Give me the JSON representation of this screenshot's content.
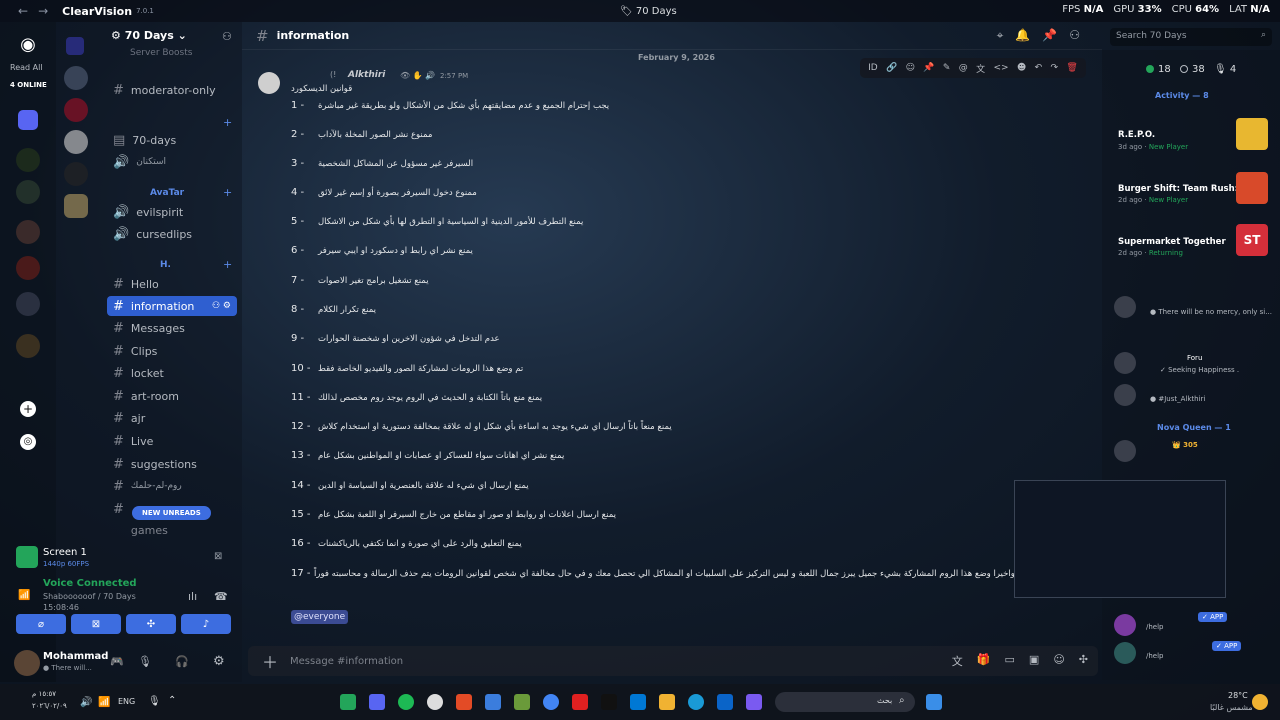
{
  "titlebar": {
    "app_name": "ClearVision",
    "version": "7.0.1",
    "window_title": "70 Days",
    "stats": [
      {
        "label": "FPS",
        "value": "N/A"
      },
      {
        "label": "GPU",
        "value": "33%"
      },
      {
        "label": "CPU",
        "value": "64%"
      },
      {
        "label": "LAT",
        "value": "N/A"
      }
    ]
  },
  "rail": {
    "read_all": "Read All",
    "online": "4 ONLINE"
  },
  "server": {
    "name": "70 Days",
    "partial_top": "Server Boosts",
    "channels": [
      {
        "name": "moderator-only"
      },
      {
        "name": "70-days"
      },
      {
        "name": "استكنان"
      },
      {
        "name": "evilspirit"
      },
      {
        "name": "cursedlips"
      },
      {
        "name": "Hello"
      },
      {
        "name": "information"
      },
      {
        "name": "Messages"
      },
      {
        "name": "Clips"
      },
      {
        "name": "locket"
      },
      {
        "name": "art-room"
      },
      {
        "name": "ajr"
      },
      {
        "name": "Live"
      },
      {
        "name": "suggestions"
      },
      {
        "name": "روم-لم-حلمك"
      },
      {
        "name": "games"
      }
    ],
    "categories": [
      "AvaTar",
      "H."
    ],
    "new_unreads": "NEW UNREADS"
  },
  "channel_header": {
    "name": "information"
  },
  "search": {
    "placeholder": "Search 70 Days"
  },
  "message": {
    "date": "February 9, 2026",
    "author": "Alkthiri",
    "time": "2:57 PM",
    "title": "قوانين الديسكورد",
    "rules": [
      {
        "n": "1 -",
        "text": "يجب إحترام الجميع و عدم مضايقتهم بأي شكل من الأشكال ولو بطريقة غير مباشرة"
      },
      {
        "n": "2 -",
        "text": "ممنوع نشر الصور المخلة بالآداب"
      },
      {
        "n": "3 -",
        "text": "السيرفر غير مسؤول عن المشاكل الشخصية"
      },
      {
        "n": "4 -",
        "text": "ممنوع دخول السيرفر بصورة أو إسم غير لائق"
      },
      {
        "n": "5 -",
        "text": "يمنع التطرف للأمور الدينية او السياسية او التطرق لها بأي شكل من الاشكال"
      },
      {
        "n": "6 -",
        "text": "يمنع نشر اي رابط او دسكورد او ايبي سيرفر"
      },
      {
        "n": "7 -",
        "text": "يمنع تشغيل برامج تغير الاصوات"
      },
      {
        "n": "8 -",
        "text": "يمنع تكرار الكلام"
      },
      {
        "n": "9 -",
        "text": "عدم التدخل في شؤون الاخرين او شخصنة الحوارات"
      },
      {
        "n": "10 -",
        "text": "تم وضع هذا الرومات لمشاركة الصور والفيديو الخاصة فقط"
      },
      {
        "n": "11 -",
        "text": "يمنع منع باتاً الكتابة و الحديث في الروم يوجد روم مخصص لذالك"
      },
      {
        "n": "12 -",
        "text": "يمنع منعاً باتاً ارسال اي شيء يوجد به اساءة بأي شكل او له علاقة بمخالفة دستورية او استخدام كلاش"
      },
      {
        "n": "13 -",
        "text": "يمنع نشر اي اهانات سواء للعساكر او عصابات او المواطنين بشكل عام"
      },
      {
        "n": "14 -",
        "text": "يمنع ارسال اي شيء له علاقة بالعنصرية او السياسة او الدين"
      },
      {
        "n": "15 -",
        "text": "يمنع ارسال اعلانات او روابط او صور او مقاطع من خارج السيرفر او اللعبة بشكل عام"
      },
      {
        "n": "16 -",
        "text": "يمنع التعليق والرد على اي صورة و انما تكتفي بالرياكشنات"
      },
      {
        "n": "17 -",
        "text": "واخيرا وضع هذا الروم المشاركة بشيء جميل يبرز جمال اللعبة و ليس التركيز على السلبيات او المشاكل الي تحصل معك و في حال مخالفة اي شخص لقوانين الرومات يتم حذف الرسالة و محاسبته فوراً"
      }
    ],
    "mention": "@everyone"
  },
  "composer": {
    "placeholder": "Message #information"
  },
  "voice": {
    "screen_label": "Screen 1",
    "screen_quality": "1440p 60FPS",
    "status": "Voice Connected",
    "location": "Shaboooooof / 70 Days",
    "elapsed": "15:08:46"
  },
  "user": {
    "name": "Mohammad",
    "status": "There will..."
  },
  "rightbar": {
    "counts": {
      "online": "18",
      "idle": "38",
      "voice": "4"
    },
    "activity_header": "Activity — 8",
    "activities": [
      {
        "title": "R.E.P.O.",
        "time": "3d ago",
        "tag": "New Player"
      },
      {
        "title": "Burger Shift: Team Rush: P...",
        "time": "2d ago",
        "tag": "New Player"
      },
      {
        "title": "Supermarket Together",
        "time": "2d ago",
        "tag": "Returning"
      }
    ],
    "members": [
      {
        "status": "There will be no mercy, only si..."
      },
      {
        "name": "Foru",
        "status": "Seeking Happiness ."
      },
      {
        "status": "#Just_Alkthiri"
      }
    ],
    "nova_header": "Nova Queen — 1",
    "nova_member": {
      "badge": "305"
    },
    "bots": [
      {
        "name": "/help",
        "badge": "APP"
      },
      {
        "name": "/help",
        "badge": "APP"
      }
    ]
  },
  "taskbar": {
    "lang": "ENG",
    "time": "١٥:٥٧ م",
    "date": "٢٠٢٦/٠٢/٠٩",
    "search": "بحث",
    "weather_temp": "28°C",
    "weather_desc": "مشمس غالبًا"
  }
}
